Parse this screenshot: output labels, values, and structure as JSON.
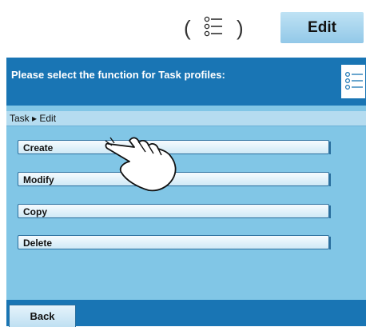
{
  "reference": {
    "paren_open": "(",
    "paren_close": ")",
    "menu_icon": "list-menu-icon",
    "edit_label": "Edit"
  },
  "header": {
    "title": "Please select the function for Task profiles:",
    "menu_icon": "list-menu-icon"
  },
  "breadcrumb": "Task ▸ Edit",
  "functions": [
    "Create",
    "Modify",
    "Copy",
    "Delete"
  ],
  "footer": {
    "back_label": "Back"
  },
  "colors": {
    "header": "#1975b4",
    "screen": "#81c6e6",
    "button": "#e6f3fb"
  }
}
